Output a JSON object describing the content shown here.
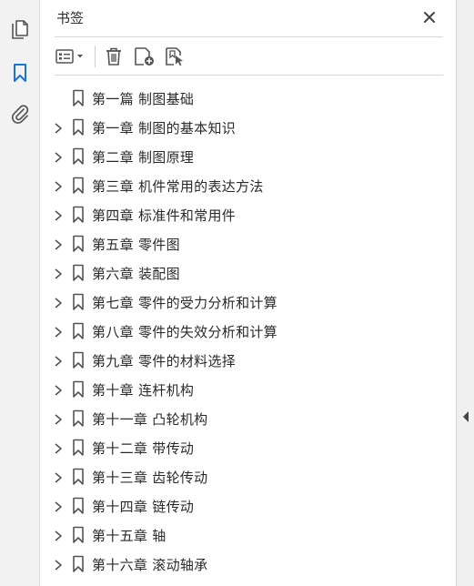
{
  "left_rail": {
    "icons": [
      "pages-icon",
      "bookmark-icon",
      "attachment-icon"
    ],
    "active": "bookmark-icon",
    "active_color": "#1a73d9"
  },
  "panel": {
    "title": "书签",
    "close_icon": "close-icon",
    "toolbar": {
      "icons": [
        "options-menu-icon",
        "delete-bookmark-icon",
        "new-bookmark-icon",
        "bookmark-from-selection-icon"
      ]
    }
  },
  "bookmarks": [
    {
      "label": "第一篇  制图基础",
      "expandable": false
    },
    {
      "label": "第一章  制图的基本知识",
      "expandable": true
    },
    {
      "label": "第二章  制图原理",
      "expandable": true
    },
    {
      "label": "第三章  机件常用的表达方法",
      "expandable": true
    },
    {
      "label": "第四章  标准件和常用件",
      "expandable": true
    },
    {
      "label": "第五章  零件图",
      "expandable": true
    },
    {
      "label": "第六章  装配图",
      "expandable": true
    },
    {
      "label": "第七章  零件的受力分析和计算",
      "expandable": true
    },
    {
      "label": "第八章  零件的失效分析和计算",
      "expandable": true
    },
    {
      "label": "第九章  零件的材料选择",
      "expandable": true
    },
    {
      "label": "第十章  连杆机构",
      "expandable": true
    },
    {
      "label": "第十一章  凸轮机构",
      "expandable": true
    },
    {
      "label": "第十二章  带传动",
      "expandable": true
    },
    {
      "label": "第十三章  齿轮传动",
      "expandable": true
    },
    {
      "label": "第十四章  链传动",
      "expandable": true
    },
    {
      "label": "第十五章  轴",
      "expandable": true
    },
    {
      "label": "第十六章  滚动轴承",
      "expandable": true
    }
  ],
  "right_rail": {
    "collapse_icon": "collapse-panel-arrow-icon"
  }
}
